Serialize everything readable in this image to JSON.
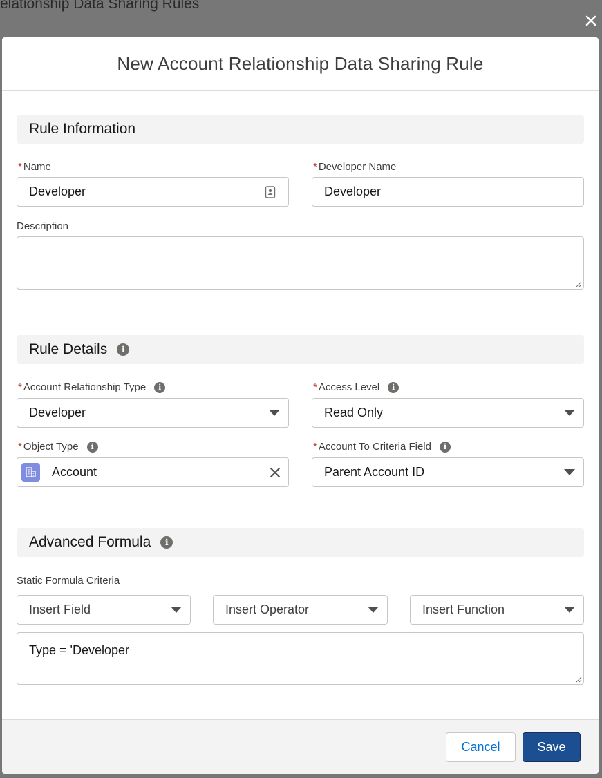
{
  "background": {
    "page_title": "elationship Data Sharing Rules"
  },
  "modal": {
    "title": "New Account Relationship Data Sharing Rule",
    "sections": {
      "rule_information": {
        "title": "Rule Information",
        "name": {
          "label": "Name",
          "value": "Developer"
        },
        "developer_name": {
          "label": "Developer Name",
          "value": "Developer"
        },
        "description": {
          "label": "Description",
          "value": ""
        }
      },
      "rule_details": {
        "title": "Rule Details",
        "account_relationship_type": {
          "label": "Account Relationship Type",
          "value": "Developer"
        },
        "access_level": {
          "label": "Access Level",
          "value": "Read Only"
        },
        "object_type": {
          "label": "Object Type",
          "value": "Account"
        },
        "account_to_criteria_field": {
          "label": "Account To Criteria Field",
          "value": "Parent Account ID"
        }
      },
      "advanced_formula": {
        "title": "Advanced Formula",
        "static_formula_label": "Static Formula Criteria",
        "insert_field": "Insert Field",
        "insert_operator": "Insert Operator",
        "insert_function": "Insert Function",
        "formula": "Type = 'Developer"
      }
    },
    "footer": {
      "cancel_label": "Cancel",
      "save_label": "Save"
    }
  },
  "icons": {
    "close": "close-icon",
    "info": "info-icon",
    "contact_card": "contact-card-icon",
    "account_object": "account-object-icon",
    "clear": "clear-icon",
    "dropdown": "chevron-down-icon"
  },
  "colors": {
    "overlay": "#777777",
    "section_bg": "#f3f3f3",
    "required": "#c23934",
    "save_button": "#1c4f91",
    "cancel_text": "#0070d2",
    "account_icon_bg": "#7f8de1"
  }
}
